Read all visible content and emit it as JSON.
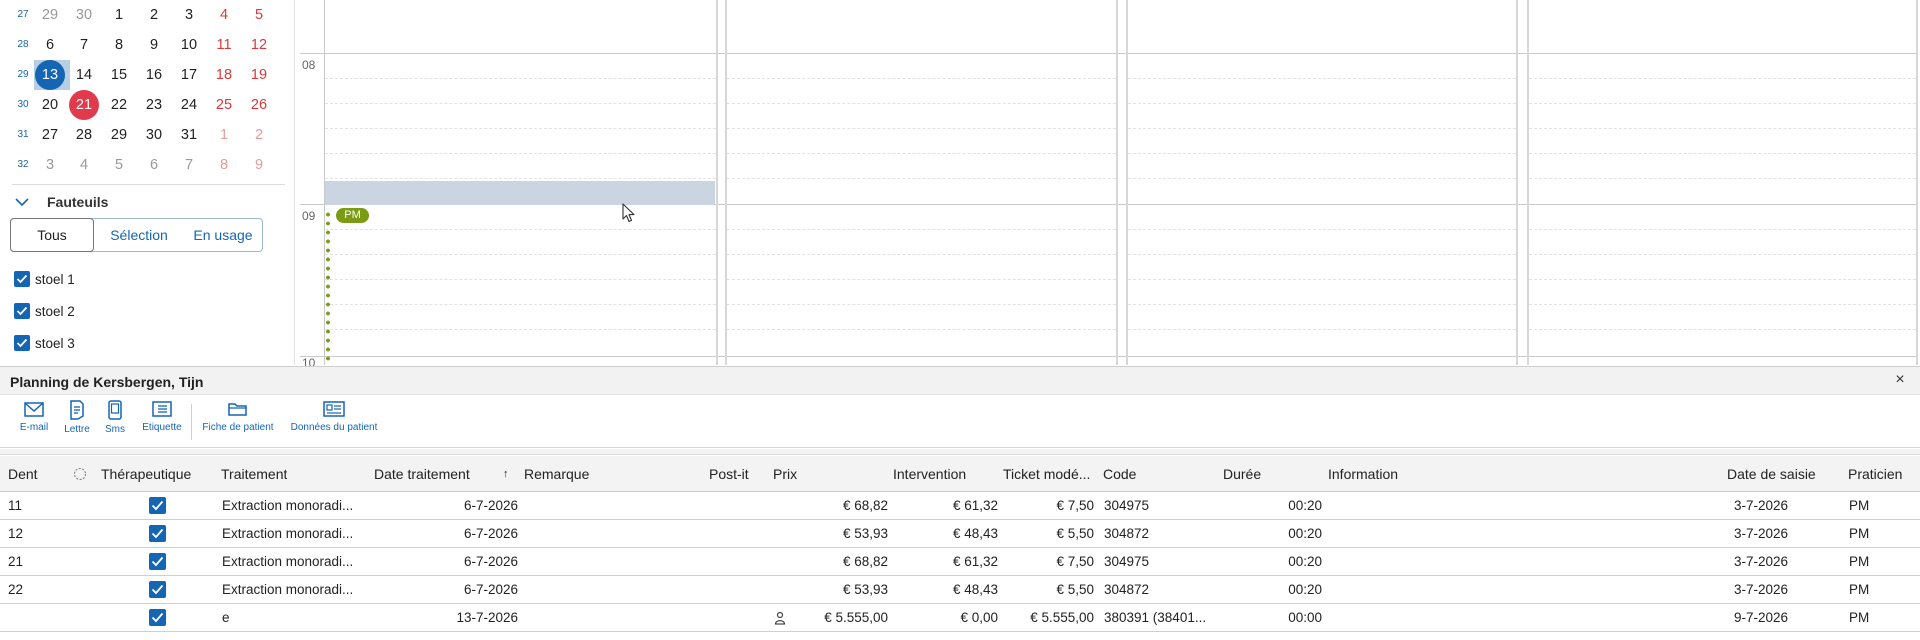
{
  "calendar": {
    "rows": [
      {
        "week": "27",
        "days": [
          {
            "d": "29",
            "muted": true,
            "we": false
          },
          {
            "d": "30",
            "muted": true,
            "we": false
          },
          {
            "d": "1",
            "muted": false,
            "we": false
          },
          {
            "d": "2",
            "muted": false,
            "we": false
          },
          {
            "d": "3",
            "muted": false,
            "we": false
          },
          {
            "d": "4",
            "muted": false,
            "we": true
          },
          {
            "d": "5",
            "muted": false,
            "we": true
          }
        ]
      },
      {
        "week": "28",
        "days": [
          {
            "d": "6",
            "muted": false,
            "we": false
          },
          {
            "d": "7",
            "muted": false,
            "we": false
          },
          {
            "d": "8",
            "muted": false,
            "we": false
          },
          {
            "d": "9",
            "muted": false,
            "we": false
          },
          {
            "d": "10",
            "muted": false,
            "we": false
          },
          {
            "d": "11",
            "muted": false,
            "we": true
          },
          {
            "d": "12",
            "muted": false,
            "we": true
          }
        ]
      },
      {
        "week": "29",
        "days": [
          {
            "d": "13",
            "muted": false,
            "we": false,
            "selected": true
          },
          {
            "d": "14",
            "muted": false,
            "we": false
          },
          {
            "d": "15",
            "muted": false,
            "we": false
          },
          {
            "d": "16",
            "muted": false,
            "we": false
          },
          {
            "d": "17",
            "muted": false,
            "we": false
          },
          {
            "d": "18",
            "muted": false,
            "we": true
          },
          {
            "d": "19",
            "muted": false,
            "we": true
          }
        ]
      },
      {
        "week": "30",
        "days": [
          {
            "d": "20",
            "muted": false,
            "we": false
          },
          {
            "d": "21",
            "muted": false,
            "we": false,
            "today": true
          },
          {
            "d": "22",
            "muted": false,
            "we": false
          },
          {
            "d": "23",
            "muted": false,
            "we": false
          },
          {
            "d": "24",
            "muted": false,
            "we": false
          },
          {
            "d": "25",
            "muted": false,
            "we": true
          },
          {
            "d": "26",
            "muted": false,
            "we": true
          }
        ]
      },
      {
        "week": "31",
        "days": [
          {
            "d": "27",
            "muted": false,
            "we": false
          },
          {
            "d": "28",
            "muted": false,
            "we": false
          },
          {
            "d": "29",
            "muted": false,
            "we": false
          },
          {
            "d": "30",
            "muted": false,
            "we": false
          },
          {
            "d": "31",
            "muted": false,
            "we": false
          },
          {
            "d": "1",
            "muted": true,
            "we": true
          },
          {
            "d": "2",
            "muted": true,
            "we": true
          }
        ]
      },
      {
        "week": "32",
        "days": [
          {
            "d": "3",
            "muted": true,
            "we": false
          },
          {
            "d": "4",
            "muted": true,
            "we": false
          },
          {
            "d": "5",
            "muted": true,
            "we": false
          },
          {
            "d": "6",
            "muted": true,
            "we": false
          },
          {
            "d": "7",
            "muted": true,
            "we": false
          },
          {
            "d": "8",
            "muted": true,
            "we": true
          },
          {
            "d": "9",
            "muted": true,
            "we": true
          }
        ]
      }
    ]
  },
  "fauteuils": {
    "title": "Fauteuils",
    "filters": [
      "Tous",
      "Sélection",
      "En usage"
    ],
    "active_filter": "Tous",
    "chairs": [
      {
        "label": "stoel 1",
        "checked": true
      },
      {
        "label": "stoel 2",
        "checked": true
      },
      {
        "label": "stoel 3",
        "checked": true
      }
    ]
  },
  "agenda": {
    "hours": [
      "08",
      "09",
      "10"
    ],
    "tag": "PM",
    "tag_color": "#7a9b12",
    "selection_color": "#cbd5e1"
  },
  "panel": {
    "title": "Planning de Kersbergen, Tijn",
    "close": "×",
    "toolbar": [
      {
        "label": "E-mail",
        "icon": "envelope-icon"
      },
      {
        "label": "Lettre",
        "icon": "letter-icon"
      },
      {
        "label": "Sms",
        "icon": "phone-icon"
      },
      {
        "label": "Etiquette",
        "icon": "label-icon"
      },
      {
        "label": "Fiche de patient",
        "icon": "folder-icon"
      },
      {
        "label": "Données du patient",
        "icon": "id-card-icon"
      }
    ]
  },
  "table": {
    "columns": {
      "dent": "Dent",
      "therapeutique": "Thérapeutique",
      "traitement": "Traitement",
      "date": "Date traitement",
      "sort": "↑",
      "remarque": "Remarque",
      "postit": "Post-it",
      "prix": "Prix",
      "intervention": "Intervention",
      "ticket": "Ticket modé...",
      "code": "Code",
      "duree": "Durée",
      "information": "Information",
      "saisie": "Date de saisie",
      "praticien": "Praticien"
    },
    "rows": [
      {
        "dent": "11",
        "therapeutique": true,
        "traitement": "Extraction monoradi...",
        "date": "6-7-2026",
        "postit": "",
        "prix": "€ 68,82",
        "intervention": "€ 61,32",
        "ticket": "€ 7,50",
        "code": "304975",
        "duree": "00:20",
        "saisie": "3-7-2026",
        "praticien": "PM"
      },
      {
        "dent": "12",
        "therapeutique": true,
        "traitement": "Extraction monoradi...",
        "date": "6-7-2026",
        "postit": "",
        "prix": "€ 53,93",
        "intervention": "€ 48,43",
        "ticket": "€ 5,50",
        "code": "304872",
        "duree": "00:20",
        "saisie": "3-7-2026",
        "praticien": "PM"
      },
      {
        "dent": "21",
        "therapeutique": true,
        "traitement": "Extraction monoradi...",
        "date": "6-7-2026",
        "postit": "",
        "prix": "€ 68,82",
        "intervention": "€ 61,32",
        "ticket": "€ 7,50",
        "code": "304975",
        "duree": "00:20",
        "saisie": "3-7-2026",
        "praticien": "PM"
      },
      {
        "dent": "22",
        "therapeutique": true,
        "traitement": "Extraction monoradi...",
        "date": "6-7-2026",
        "postit": "",
        "prix": "€ 53,93",
        "intervention": "€ 48,43",
        "ticket": "€ 5,50",
        "code": "304872",
        "duree": "00:20",
        "saisie": "3-7-2026",
        "praticien": "PM"
      },
      {
        "dent": "",
        "therapeutique": true,
        "traitement": "e",
        "date": "13-7-2026",
        "postit": "person-icon",
        "prix": "€ 5.555,00",
        "intervention": "€ 0,00",
        "ticket": "€ 5.555,00",
        "code": "380391 (38401...",
        "duree": "00:00",
        "saisie": "9-7-2026",
        "praticien": "PM"
      }
    ]
  }
}
